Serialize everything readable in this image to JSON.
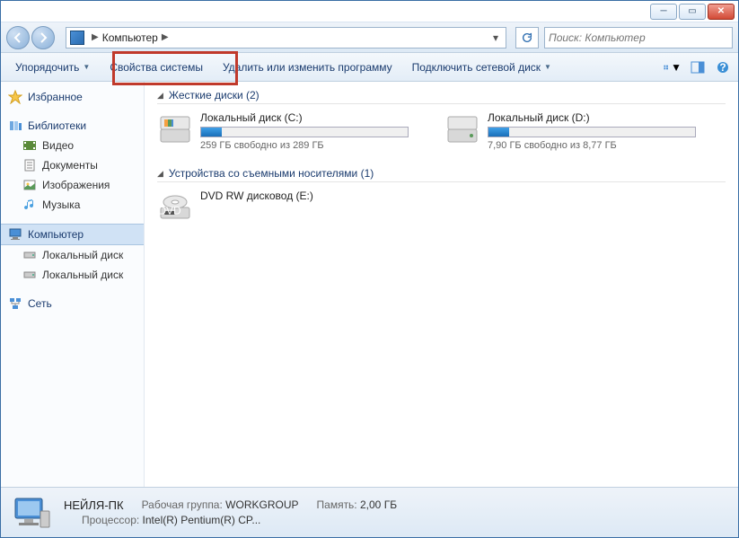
{
  "nav": {
    "crumb": "Компьютер"
  },
  "search": {
    "placeholder": "Поиск: Компьютер"
  },
  "toolbar": {
    "organize": "Упорядочить",
    "properties": "Свойства системы",
    "uninstall": "Удалить или изменить программу",
    "mapdrive": "Подключить сетевой диск"
  },
  "sidebar": {
    "favorites": "Избранное",
    "libraries": "Библиотеки",
    "video": "Видео",
    "documents": "Документы",
    "pictures": "Изображения",
    "music": "Музыка",
    "computer": "Компьютер",
    "localdisk1": "Локальный диск",
    "localdisk2": "Локальный диск",
    "network": "Сеть"
  },
  "cats": {
    "hdd": {
      "title": "Жесткие диски (2)"
    },
    "removable": {
      "title": "Устройства со съемными носителями (1)"
    }
  },
  "drives": {
    "c": {
      "label": "Локальный диск (C:)",
      "status": "259 ГБ свободно из 289 ГБ",
      "fill_pct": 10
    },
    "d": {
      "label": "Локальный диск (D:)",
      "status": "7,90 ГБ свободно из 8,77 ГБ",
      "fill_pct": 10
    },
    "e": {
      "label": "DVD RW дисковод (E:)"
    }
  },
  "status": {
    "name": "НЕЙЛЯ-ПК",
    "workgroup_lbl": "Рабочая группа:",
    "workgroup": "WORKGROUP",
    "mem_lbl": "Память:",
    "mem": "2,00 ГБ",
    "cpu_lbl": "Процессор:",
    "cpu": "Intel(R) Pentium(R) CP..."
  }
}
